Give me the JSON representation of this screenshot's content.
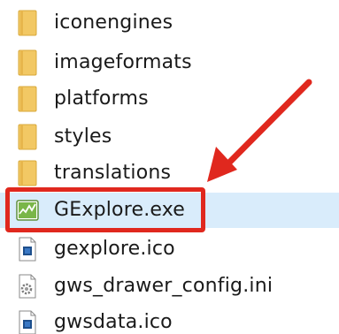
{
  "files": [
    {
      "name": "iconengines",
      "type": "folder"
    },
    {
      "name": "imageformats",
      "type": "folder"
    },
    {
      "name": "platforms",
      "type": "folder"
    },
    {
      "name": "styles",
      "type": "folder"
    },
    {
      "name": "translations",
      "type": "folder"
    },
    {
      "name": "GExplore.exe",
      "type": "exe",
      "selected": true
    },
    {
      "name": "gexplore.ico",
      "type": "ico"
    },
    {
      "name": "gws_drawer_config.ini",
      "type": "ini"
    },
    {
      "name": "gwsdata.ico",
      "type": "ico"
    }
  ],
  "annotation": {
    "color": "#e0281e",
    "target": "GExplore.exe"
  }
}
